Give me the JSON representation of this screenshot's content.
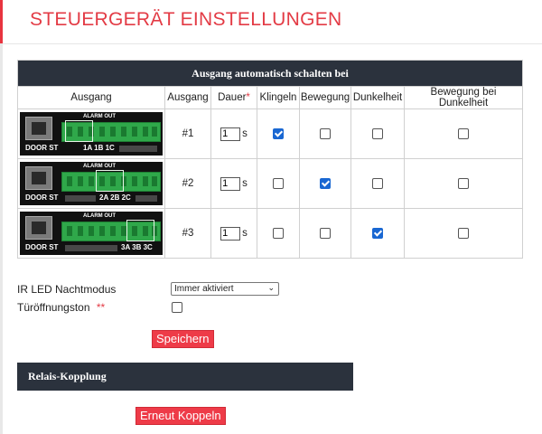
{
  "page": {
    "title": "STEUERGERÄT EINSTELLUNGEN"
  },
  "table": {
    "caption": "Ausgang automatisch schalten bei",
    "headers": {
      "ausgang_img": "Ausgang",
      "ausgang_num": "Ausgang",
      "dauer": "Dauer",
      "dauer_required": "*",
      "klingeln": "Klingeln",
      "bewegung": "Bewegung",
      "dunkelheit": "Dunkelheit",
      "bewegung_dunkelheit": "Bewegung bei Dunkelheit"
    },
    "unit": "s",
    "rows": [
      {
        "num": "#1",
        "duration": "1",
        "pins": "1A 1B 1C",
        "checks": [
          true,
          false,
          false,
          false
        ]
      },
      {
        "num": "#2",
        "duration": "1",
        "pins": "2A 2B 2C",
        "checks": [
          false,
          true,
          false,
          false
        ]
      },
      {
        "num": "#3",
        "duration": "1",
        "pins": "3A 3B 3C",
        "checks": [
          false,
          false,
          true,
          false
        ]
      }
    ],
    "connector": {
      "door_label": "DOOR ST",
      "alarm_label": "ALARM OUT"
    }
  },
  "form": {
    "ir_led_label": "IR LED Nachtmodus",
    "ir_led_value": "Immer aktiviert",
    "door_tone_label": "Türöffnungston",
    "door_tone_required": "**",
    "door_tone_checked": false,
    "save_label": "Speichern"
  },
  "relay": {
    "title": "Relais-Kopplung",
    "button_label": "Erneut Koppeln"
  },
  "colors": {
    "accent": "#ee3b48",
    "header_bar": "#2b323d",
    "check": "#1967d2"
  }
}
